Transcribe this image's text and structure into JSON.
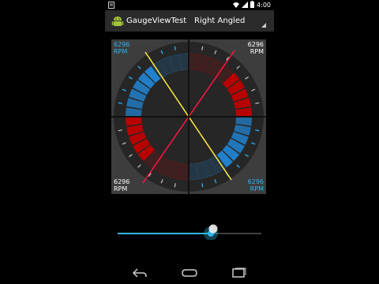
{
  "status": {
    "time": "4:00",
    "icons": [
      "notification-icon",
      "wifi-icon",
      "signal-icon",
      "battery-icon"
    ]
  },
  "action_bar": {
    "title": "GaugeViewTest",
    "spinner_value": "Right Angled",
    "app_icon": "android-robot-icon"
  },
  "gauges": [
    {
      "id": "top-left",
      "rpm_value": "6296",
      "rpm_unit": "RPM",
      "color": "#2196f3",
      "label_color": "#29b6f6"
    },
    {
      "id": "top-right",
      "rpm_value": "6296",
      "rpm_unit": "RPM",
      "color": "#c00000",
      "label_color": "#ffffff"
    },
    {
      "id": "bottom-left",
      "rpm_value": "6296",
      "rpm_unit": "RPM",
      "color": "#c00000",
      "label_color": "#ffffff"
    },
    {
      "id": "bottom-right",
      "rpm_value": "6296",
      "rpm_unit": "RPM",
      "color": "#2196f3",
      "label_color": "#29b6f6"
    }
  ],
  "seekbar": {
    "fraction": 0.65,
    "track_color": "#33b5e5"
  },
  "nav": {
    "back": "back-icon",
    "home": "home-icon",
    "recents": "recents-icon"
  }
}
